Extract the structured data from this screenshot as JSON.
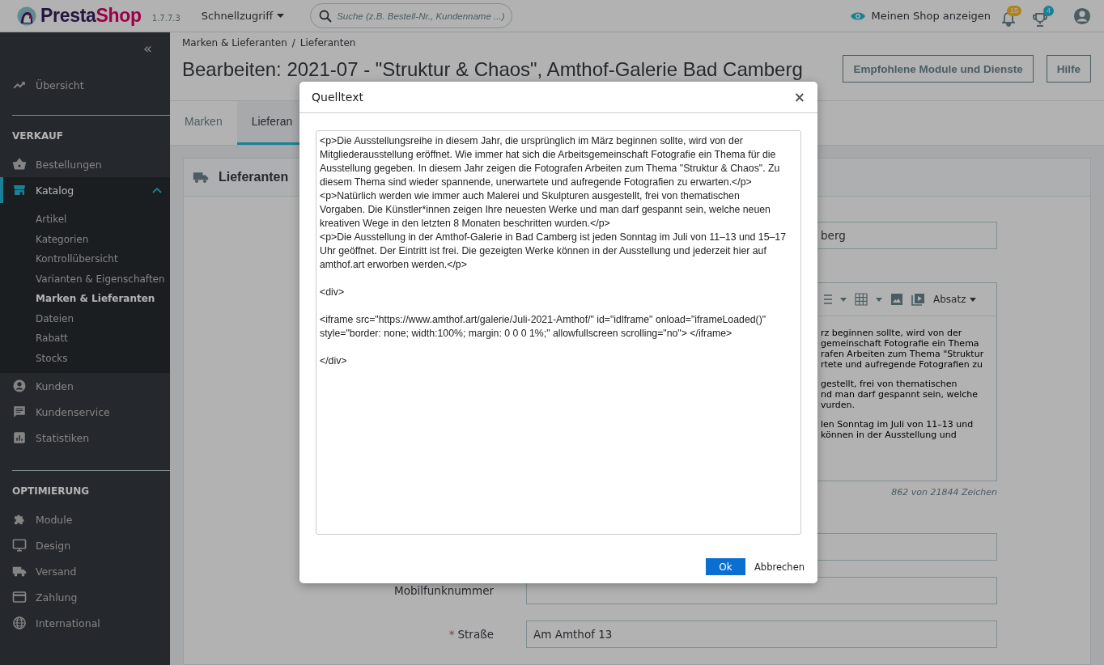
{
  "header": {
    "brand_part_1": "Presta",
    "brand_part_2": "Shop",
    "version": "1.7.7.3",
    "quick_access": "Schnellzugriff",
    "search": {
      "placeholder": "Suche (z.B. Bestell-Nr., Kundenname ...)"
    },
    "view_shop": "Meinen Shop anzeigen",
    "notifications": [
      {
        "count": "15",
        "color": "#b08318"
      },
      {
        "count": "4",
        "color": "#1a8297"
      }
    ]
  },
  "sidebar": {
    "collapse": "«",
    "sections": [
      {
        "items": [
          {
            "label": "Übersicht",
            "selected": false,
            "expanded": false
          }
        ]
      },
      {
        "title": "VERKAUF",
        "items": [
          {
            "label": "Bestellungen",
            "selected": false,
            "expanded": false
          },
          {
            "label": "Katalog",
            "selected": true,
            "expanded": true,
            "children": [
              {
                "label": "Artikel",
                "selected": false
              },
              {
                "label": "Kategorien",
                "selected": false
              },
              {
                "label": "Kontrollübersicht",
                "selected": false
              },
              {
                "label": "Varianten & Eigenschaften",
                "selected": false
              },
              {
                "label": "Marken & Lieferanten",
                "selected": true
              },
              {
                "label": "Dateien",
                "selected": false
              },
              {
                "label": "Rabatt",
                "selected": false
              },
              {
                "label": "Stocks",
                "selected": false
              }
            ]
          },
          {
            "label": "Kunden",
            "selected": false,
            "expanded": false
          },
          {
            "label": "Kundenservice",
            "selected": false,
            "expanded": false
          },
          {
            "label": "Statistiken",
            "selected": false,
            "expanded": false
          }
        ]
      },
      {
        "title": "OPTIMIERUNG",
        "items": [
          {
            "label": "Module",
            "selected": false,
            "expanded": false
          },
          {
            "label": "Design",
            "selected": false,
            "expanded": false
          },
          {
            "label": "Versand",
            "selected": false,
            "expanded": false
          },
          {
            "label": "Zahlung",
            "selected": false,
            "expanded": false
          },
          {
            "label": "International",
            "selected": false,
            "expanded": false
          }
        ]
      }
    ]
  },
  "page": {
    "breadcrumb": [
      "Marken & Lieferanten",
      "Lieferanten"
    ],
    "breadcrumb_separator": "/",
    "title": "Bearbeiten: 2021-07 - \"Struktur & Chaos\", Amthof-Galerie Bad Camberg",
    "buttons": [
      "Empfohlene Module und Dienste",
      "Hilfe"
    ],
    "tabs": [
      {
        "label": "Marken",
        "selected": false
      },
      {
        "label": "Lieferan",
        "selected": true
      }
    ]
  },
  "card": {
    "title": "Lieferanten",
    "required_mark": "*",
    "rows": [
      {
        "kind": "field",
        "value": "berg"
      },
      {
        "kind": "editor",
        "toolbar_dropdown": "Absatz",
        "paragraphs": [
          [
            "rz beginnen sollte, wird von der",
            "gemeinschaft Fotografie ein Thema",
            "rafen Arbeiten zum Thema \"Struktur",
            "rtete und aufregende Fotografien zu"
          ],
          [
            "gestellt, frei von thematischen",
            "nd man darf gespannt sein, welche",
            "vurden."
          ],
          [
            "len Sonntag im Juli von 11–13 und",
            "können in der Ausstellung und"
          ]
        ],
        "counter": "862 von 21844 Zeichen"
      },
      {
        "kind": "field"
      },
      {
        "kind": "field",
        "label": "Mobilfunknummer",
        "required": false
      },
      {
        "kind": "field",
        "label": "Straße",
        "required": true,
        "value": "Am Amthof 13"
      }
    ]
  },
  "dialog": {
    "title": "Quelltext",
    "close": "×",
    "source": "<p>Die Ausstellungsreihe in diesem Jahr, die ursprünglich im März beginnen sollte, wird von der\nMitgliederausstellung eröffnet. Wie immer hat sich die Arbeitsgemeinschaft Fotografie ein Thema für die\nAusstellung gegeben. In diesem Jahr zeigen die Fotografen Arbeiten zum Thema \"Struktur & Chaos\". Zu\ndiesem Thema sind wieder spannende, unerwartete und aufregende Fotografien zu erwarten.</p>\n<p>Natürlich werden wie immer auch Malerei und Skulpturen ausgestellt, frei von thematischen\nVorgaben. Die Künstler*innen zeigen Ihre neuesten Werke und man darf gespannt sein, welche neuen\nkreativen Wege in den letzten 8 Monaten beschritten wurden.</p>\n<p>Die Ausstellung in der Amthof-Galerie in Bad Camberg ist jeden Sonntag im Juli von 11–13 und 15–17\nUhr geöffnet. Der Eintritt ist frei. Die gezeigten Werke können in der Ausstellung und jederzeit hier auf\namthof.art erworben werden.</p>\n\n<div>\n\n<iframe src=\"https://www.amthof.art/galerie/Juli-2021-Amthof/\" id=\"idlframe\" onload=\"iframeLoaded()\"\nstyle=\"border: none; width:100%; margin: 0 0 0 1%;\" allowfullscreen scrolling=\"no\"> </iframe>\n\n</div>",
    "ok": "Ok",
    "cancel": "Abbrechen"
  }
}
